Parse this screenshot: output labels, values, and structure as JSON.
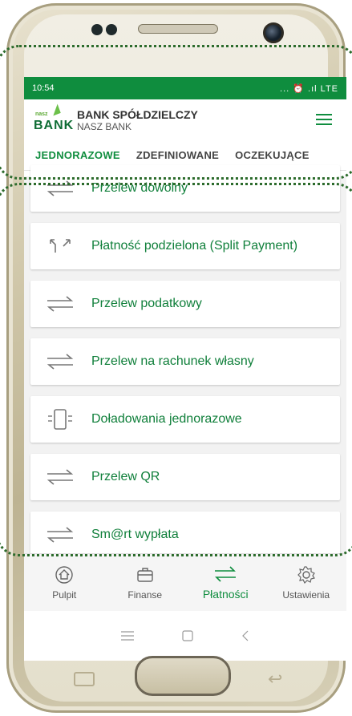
{
  "status": {
    "time": "10:54",
    "icons": "... ⏰ .ıl LTE"
  },
  "app": {
    "logo_small": "nasz",
    "logo_big": "BANK",
    "title": "BANK SPÓŁDZIELCZY",
    "subtitle": "NASZ BANK"
  },
  "tabs": [
    {
      "label": "JEDNORAZOWE",
      "active": true
    },
    {
      "label": "ZDEFINIOWANE",
      "active": false
    },
    {
      "label": "OCZEKUJĄCE",
      "active": false
    }
  ],
  "items": [
    {
      "label": "Przelew dowolny",
      "icon": "transfer-icon"
    },
    {
      "label": "Płatność podzielona (Split Payment)",
      "icon": "split-payment-icon"
    },
    {
      "label": "Przelew podatkowy",
      "icon": "transfer-icon"
    },
    {
      "label": "Przelew na rachunek własny",
      "icon": "transfer-icon"
    },
    {
      "label": "Doładowania jednorazowe",
      "icon": "phone-topup-icon"
    },
    {
      "label": "Przelew QR",
      "icon": "transfer-icon"
    },
    {
      "label": "Sm@rt wypłata",
      "icon": "transfer-icon"
    }
  ],
  "bottom_nav": [
    {
      "label": "Pulpit",
      "icon": "home-icon",
      "active": false
    },
    {
      "label": "Finanse",
      "icon": "briefcase-icon",
      "active": false
    },
    {
      "label": "Płatności",
      "icon": "transfer-icon",
      "active": true
    },
    {
      "label": "Ustawienia",
      "icon": "gear-icon",
      "active": false
    }
  ],
  "colors": {
    "brand_green": "#0f8d3e",
    "label_green": "#0f7f3a"
  }
}
